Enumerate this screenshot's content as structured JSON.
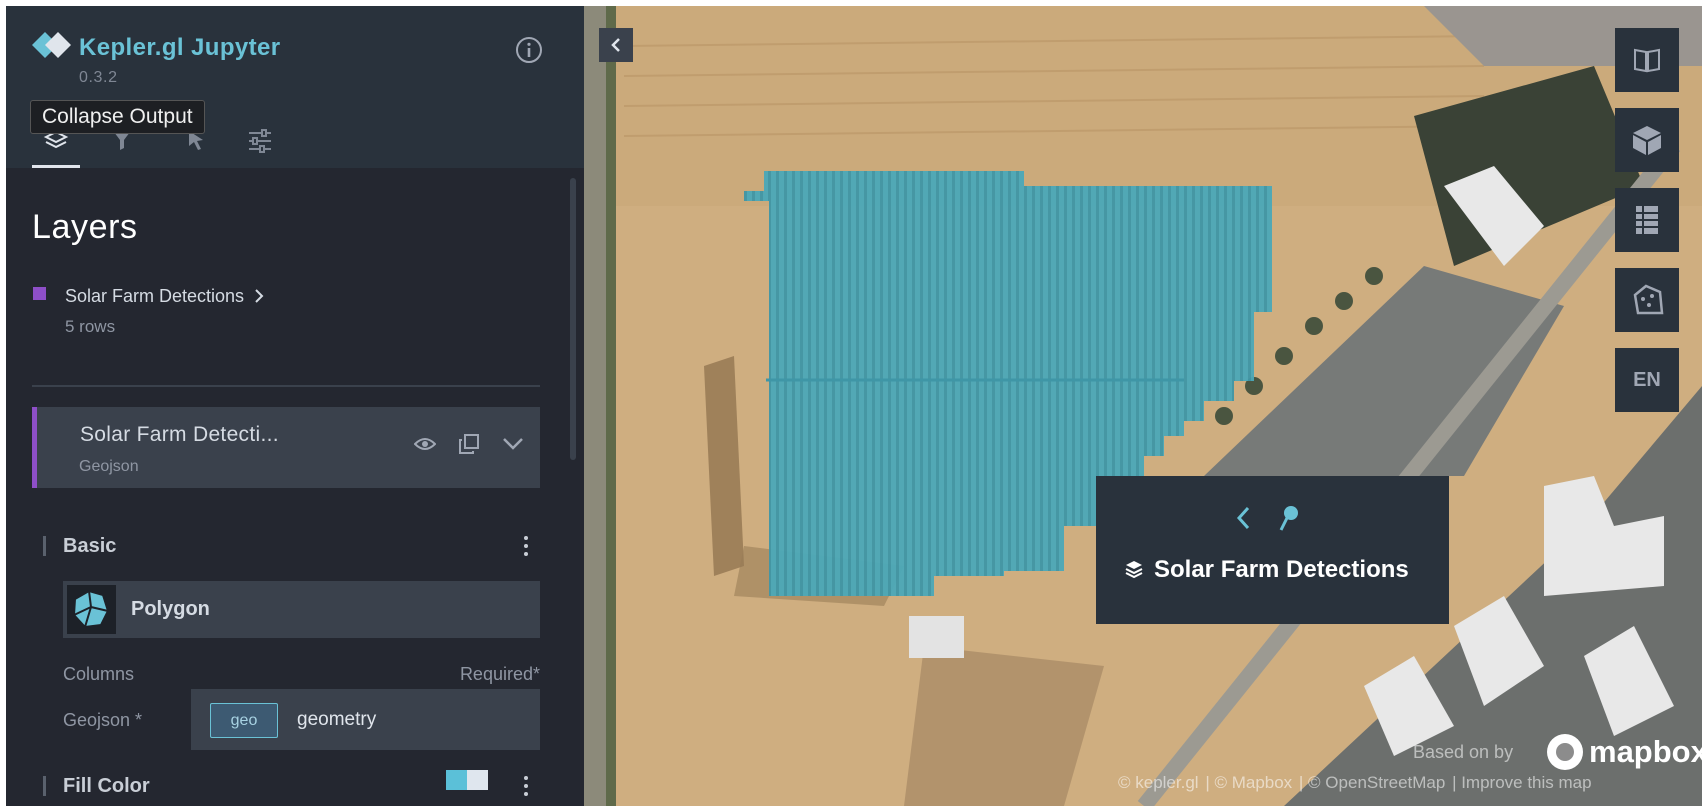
{
  "app": {
    "title": "Kepler.gl Jupyter",
    "version": "0.3.2",
    "accent_color": "#6ac2d6",
    "tooltip": "Collapse Output"
  },
  "tabs": [
    {
      "name": "layers",
      "icon": "layers-icon",
      "active": true
    },
    {
      "name": "filters",
      "icon": "filter-icon",
      "active": false
    },
    {
      "name": "interactions",
      "icon": "cursor-icon",
      "active": false
    },
    {
      "name": "base-map",
      "icon": "sliders-icon",
      "active": false
    }
  ],
  "sidebar": {
    "heading": "Layers",
    "dataset": {
      "name": "Solar Farm Detections",
      "rows": "5 rows",
      "color": "#8e4fc8"
    },
    "layer": {
      "name": "Solar Farm Detecti...",
      "type": "Geojson"
    },
    "basic": {
      "title": "Basic",
      "layer_type": "Polygon"
    },
    "columns": {
      "label": "Columns",
      "required": "Required*",
      "field_label": "Geojson *",
      "field_type": "geo",
      "field_name": "geometry"
    },
    "fill_color": {
      "title": "Fill Color",
      "colors": [
        "#5bc0d8",
        "#dfe6ee"
      ]
    }
  },
  "map": {
    "controls": [
      {
        "name": "split-map",
        "icon": "book-icon"
      },
      {
        "name": "3d-view",
        "icon": "cube-icon"
      },
      {
        "name": "legend",
        "icon": "table-icon"
      },
      {
        "name": "draw",
        "icon": "polygon-icon"
      },
      {
        "name": "locale",
        "label": "EN"
      }
    ],
    "polygon_color": "#4fb0c2",
    "popup": {
      "title": "Solar Farm Detections"
    },
    "attribution": {
      "based_on": "Based on by",
      "logo": "mapbox",
      "links": [
        "© kepler.gl",
        "| © Mapbox",
        "| © OpenStreetMap",
        "| Improve this map"
      ]
    }
  }
}
